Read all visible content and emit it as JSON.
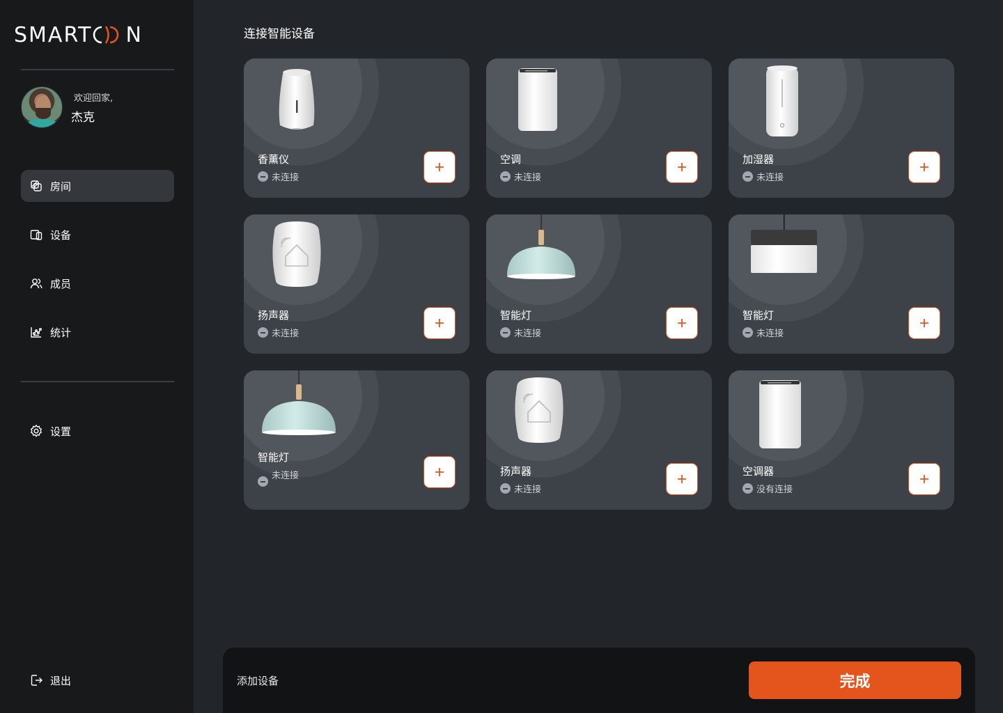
{
  "app": {
    "logo_text_left": "SMART",
    "logo_text_right": "N"
  },
  "user": {
    "greeting": "欢迎回家,",
    "name": "杰克"
  },
  "nav": {
    "rooms": "房间",
    "devices": "设备",
    "members": "成员",
    "stats": "统计",
    "settings": "设置",
    "logout": "退出"
  },
  "main": {
    "title": "连接智能设备"
  },
  "devices": [
    {
      "name": "香薰仪",
      "status": "未连接",
      "icon": "diffuser"
    },
    {
      "name": "空调",
      "status": "未连接",
      "icon": "air-conditioner"
    },
    {
      "name": "加湿器",
      "status": "未连接",
      "icon": "humidifier"
    },
    {
      "name": "扬声器",
      "status": "未连接",
      "icon": "smart-speaker"
    },
    {
      "name": "智能灯",
      "status": "未连接",
      "icon": "pendant-lamp-mint"
    },
    {
      "name": "智能灯",
      "status": "未连接",
      "icon": "pendant-lamp-drum"
    },
    {
      "name": "智能灯",
      "status": "未连接",
      "icon": "pendant-lamp-mint"
    },
    {
      "name": "扬声器",
      "status": "未连接",
      "icon": "smart-speaker"
    },
    {
      "name": "空调器",
      "status": "没有连接",
      "icon": "air-conditioner"
    }
  ],
  "footer": {
    "label": "添加设备",
    "done_label": "完成"
  },
  "colors": {
    "accent": "#e4551e",
    "sidebar_bg": "#18191b",
    "main_bg": "#222529",
    "card_bg": "#3d4148"
  }
}
